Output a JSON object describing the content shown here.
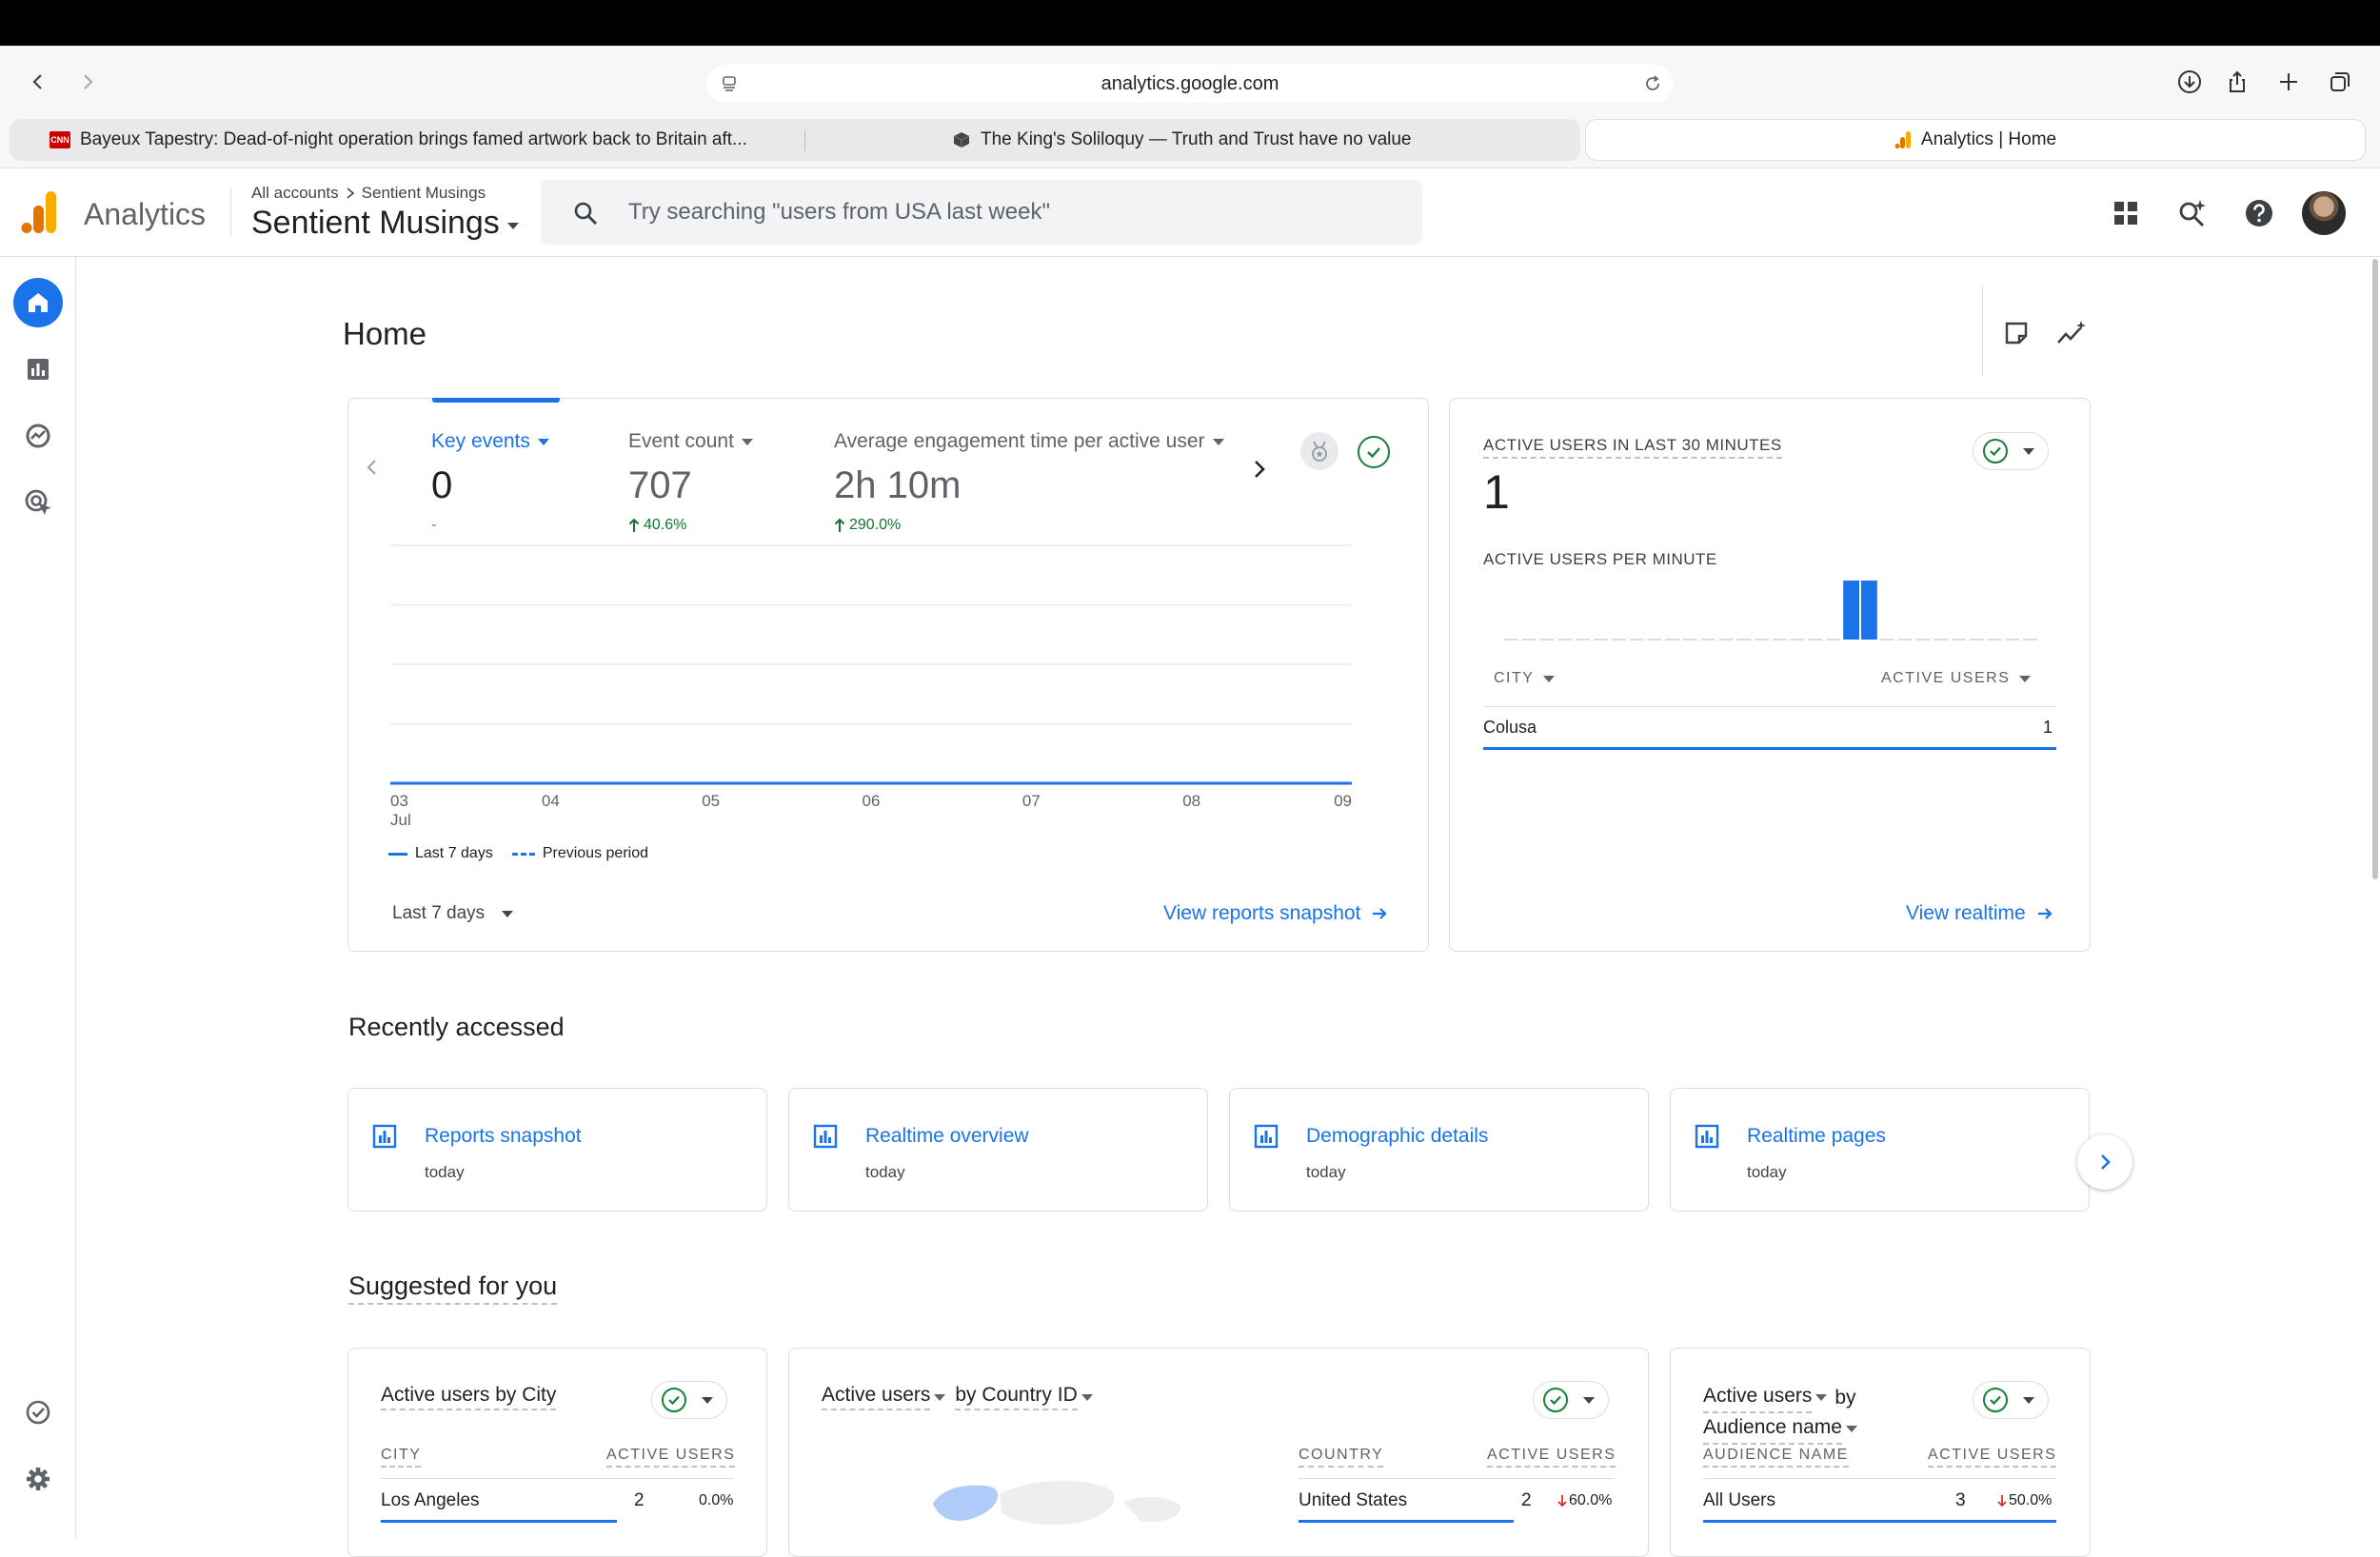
{
  "browser": {
    "url": "analytics.google.com",
    "tabs": [
      {
        "title": "Bayeux Tapestry: Dead-of-night operation brings famed artwork back to Britain aft...",
        "favicon": "cnn-logo",
        "favicon_text": "CNN"
      },
      {
        "title": "The King's Soliloquy — Truth and Trust have no value",
        "favicon": "cube-icon"
      },
      {
        "title": "Analytics | Home",
        "favicon": "analytics-logo",
        "active": true
      }
    ]
  },
  "header": {
    "app_name": "Analytics",
    "breadcrumb": {
      "root": "All accounts",
      "child": "Sentient Musings"
    },
    "property": "Sentient Musings",
    "search_placeholder": "Try searching \"users from USA last week\""
  },
  "page": {
    "title": "Home"
  },
  "overview_card": {
    "metrics": [
      {
        "label": "Key events",
        "value": "0",
        "delta": "-",
        "selected": true
      },
      {
        "label": "Event count",
        "value": "707",
        "delta": "40.6%",
        "delta_direction": "up"
      },
      {
        "label": "Average engagement time per active user",
        "value": "2h 10m",
        "delta": "290.0%",
        "delta_direction": "up"
      }
    ],
    "x_ticks": [
      "03",
      "04",
      "05",
      "06",
      "07",
      "08",
      "09"
    ],
    "x_month": "Jul",
    "legend": {
      "current": "Last 7 days",
      "previous": "Previous period"
    },
    "date_range": "Last 7 days",
    "link": "View reports snapshot"
  },
  "chart_data": {
    "type": "line",
    "x": [
      "03 Jul",
      "04 Jul",
      "05 Jul",
      "06 Jul",
      "07 Jul",
      "08 Jul",
      "09 Jul"
    ],
    "series": [
      {
        "name": "Last 7 days",
        "values": [
          0,
          0,
          0,
          0,
          0,
          0,
          0
        ]
      },
      {
        "name": "Previous period",
        "values": [
          0,
          0,
          0,
          0,
          0,
          0,
          0
        ]
      }
    ],
    "xlabel": "",
    "ylabel": "",
    "grid": true,
    "legend": "bottom-left"
  },
  "realtime_card": {
    "title": "ACTIVE USERS IN LAST 30 MINUTES",
    "value": "1",
    "subtitle": "ACTIVE USERS PER MINUTE",
    "per_minute": [
      0,
      0,
      0,
      0,
      0,
      0,
      0,
      0,
      0,
      0,
      0,
      0,
      0,
      0,
      0,
      0,
      0,
      0,
      0,
      1,
      1,
      0,
      0,
      0,
      0,
      0,
      0,
      0,
      0,
      0
    ],
    "col_city": "CITY",
    "col_users": "ACTIVE USERS",
    "rows": [
      {
        "city": "Colusa",
        "users": "1"
      }
    ],
    "link": "View realtime"
  },
  "recent": {
    "heading": "Recently accessed",
    "items": [
      {
        "name": "Reports snapshot",
        "time": "today"
      },
      {
        "name": "Realtime overview",
        "time": "today"
      },
      {
        "name": "Demographic details",
        "time": "today"
      },
      {
        "name": "Realtime pages",
        "time": "today"
      }
    ]
  },
  "suggested": {
    "heading": "Suggested for you",
    "cards": [
      {
        "title_a": "Active users by City",
        "col1": "CITY",
        "col2": "ACTIVE USERS",
        "row_name": "Los Angeles",
        "row_value": "2",
        "row_delta": "0.0%"
      },
      {
        "title_a": "Active users",
        "title_b": "by Country ID",
        "col1": "COUNTRY",
        "col2": "ACTIVE USERS",
        "row_name": "United States",
        "row_value": "2",
        "row_delta": "60.0%"
      },
      {
        "title_a": "Active users",
        "title_b": "by",
        "title_c": "Audience name",
        "col1": "AUDIENCE NAME",
        "col2": "ACTIVE USERS",
        "row_name": "All Users",
        "row_value": "3",
        "row_delta": "50.0%"
      }
    ]
  },
  "colors": {
    "accent": "#1a73e8",
    "positive": "#137333",
    "negative": "#d93025",
    "logo_orange": "#f9ab00",
    "logo_dark_orange": "#e37400"
  }
}
